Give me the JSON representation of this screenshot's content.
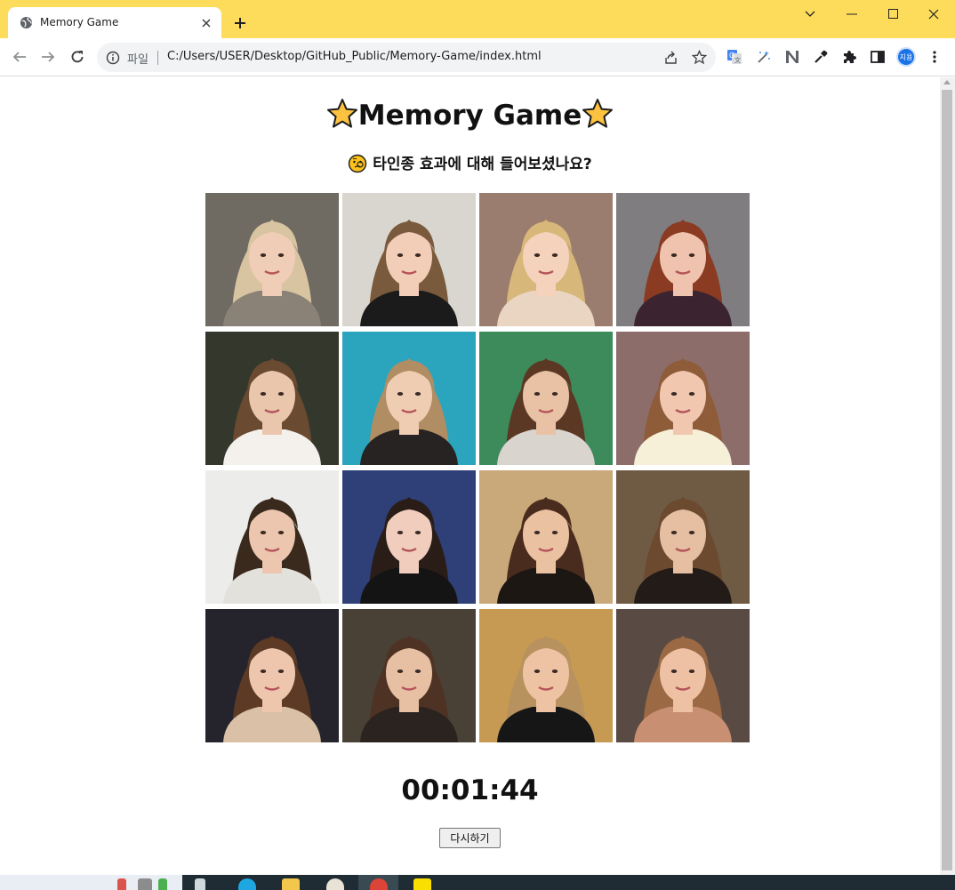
{
  "browser": {
    "tab_title": "Memory Game",
    "scheme_label": "파일",
    "url": "C:/Users/USER/Desktop/GitHub_Public/Memory-Game/index.html",
    "profile_label": "지용",
    "accent_color": "#fddc5c",
    "icons": [
      "globe-icon",
      "close-icon",
      "plus-icon",
      "chevron-down-icon",
      "minimize-icon",
      "maximize-icon",
      "close-window-icon",
      "back-arrow-icon",
      "forward-arrow-icon",
      "reload-icon",
      "info-icon",
      "share-icon",
      "star-bookmark-icon",
      "translate-icon",
      "magic-icon",
      "extension-n-icon",
      "eyedropper-icon",
      "puzzle-icon",
      "side-panel-icon",
      "more-vert-icon"
    ]
  },
  "page": {
    "title": "Memory Game",
    "title_icon": "star-emoji",
    "subtitle": "타인종 효과에 대해 들어보셨나요?",
    "subtitle_icon": "thinking-face-emoji",
    "timer": "00:01:44",
    "restart_label": "다시하기"
  },
  "cards": [
    {
      "bg": "#6f6a62",
      "hair": "#d8c4a0",
      "skin": "#f0cdb6",
      "cloth": "#8a8276"
    },
    {
      "bg": "#d9d6cf",
      "hair": "#7a5a3c",
      "skin": "#f2cdb8",
      "cloth": "#1b1b1b"
    },
    {
      "bg": "#9a7d6e",
      "hair": "#d8b77a",
      "skin": "#f4d2bc",
      "cloth": "#e9d5c2"
    },
    {
      "bg": "#7f7d80",
      "hair": "#8a3b22",
      "skin": "#efc3ad",
      "cloth": "#3b2430"
    },
    {
      "bg": "#34382c",
      "hair": "#6a4a30",
      "skin": "#eac6ad",
      "cloth": "#f4f1ec"
    },
    {
      "bg": "#2aa5bd",
      "hair": "#b08d62",
      "skin": "#efcdb3",
      "cloth": "#262322"
    },
    {
      "bg": "#3d8a5a",
      "hair": "#5a3824",
      "skin": "#e9c2a5",
      "cloth": "#d9d4cd"
    },
    {
      "bg": "#8c6d6a",
      "hair": "#8f5c3a",
      "skin": "#f1c7b0",
      "cloth": "#f7f0d9"
    },
    {
      "bg": "#ececea",
      "hair": "#3a2a1e",
      "skin": "#ecc6ae",
      "cloth": "#e3e1db"
    },
    {
      "bg": "#2f3f77",
      "hair": "#2a1d18",
      "skin": "#f0cdbd",
      "cloth": "#141414"
    },
    {
      "bg": "#c9a97a",
      "hair": "#4a2c1e",
      "skin": "#eac1a1",
      "cloth": "#1d1714"
    },
    {
      "bg": "#6f5a44",
      "hair": "#6b4a30",
      "skin": "#e6bfa2",
      "cloth": "#231b18"
    },
    {
      "bg": "#25242c",
      "hair": "#5c3a26",
      "skin": "#eec6ae",
      "cloth": "#d9c0a6"
    },
    {
      "bg": "#4a4136",
      "hair": "#4e3324",
      "skin": "#e7c0a4",
      "cloth": "#2a2320"
    },
    {
      "bg": "#c69a52",
      "hair": "#b8925e",
      "skin": "#eec3a4",
      "cloth": "#161616"
    },
    {
      "bg": "#5a4a44",
      "hair": "#9b6a44",
      "skin": "#eec1a5",
      "cloth": "#c98f72"
    }
  ]
}
